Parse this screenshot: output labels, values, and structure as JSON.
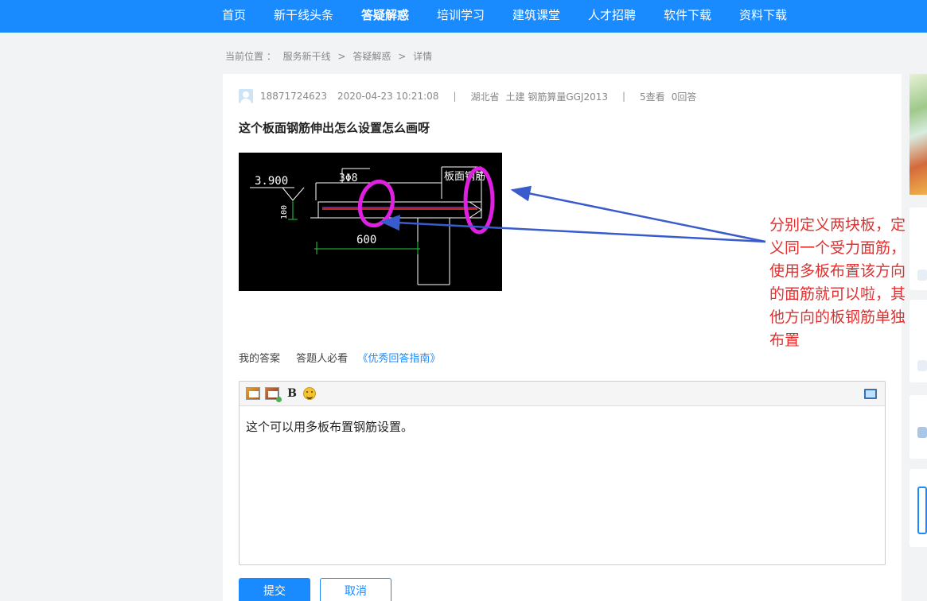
{
  "nav": {
    "items": [
      "首页",
      "新干线头条",
      "答疑解惑",
      "培训学习",
      "建筑课堂",
      "人才招聘",
      "软件下载",
      "资料下载"
    ],
    "active": "答疑解惑"
  },
  "breadcrumb": {
    "label": "当前位置 ：",
    "items": [
      "服务新干线",
      ">",
      "答疑解惑",
      ">",
      "详情"
    ]
  },
  "question": {
    "user": "18871724623",
    "datetime": "2020-04-23 10:21:08",
    "separator": "|",
    "location": "湖北省",
    "category": "土建 钢筋算量GGJ2013",
    "views": "5查看",
    "answers": "0回答",
    "title": "这个板面钢筋伸出怎么设置怎么画呀"
  },
  "drawing": {
    "elevation": "3.900",
    "rebar": "3Φ8",
    "dim": "600",
    "side_dim": "100",
    "note": "板面钢筋"
  },
  "annotation": {
    "text": "分别定义两块板，定义同一个受力面筋，使用多板布置该方向的面筋就可以啦，其他方向的板钢筋单独布置"
  },
  "answer": {
    "my_answer": "我的答案",
    "must_read": "答题人必看",
    "guide": "《优秀回答指南》",
    "content": "这个可以用多板布置钢筋设置。",
    "bold_label": "B",
    "submit": "提交",
    "cancel": "取消"
  },
  "colors": {
    "primary": "#1a8bff",
    "annotation": "#e0302f",
    "circle": "#e020e0"
  }
}
